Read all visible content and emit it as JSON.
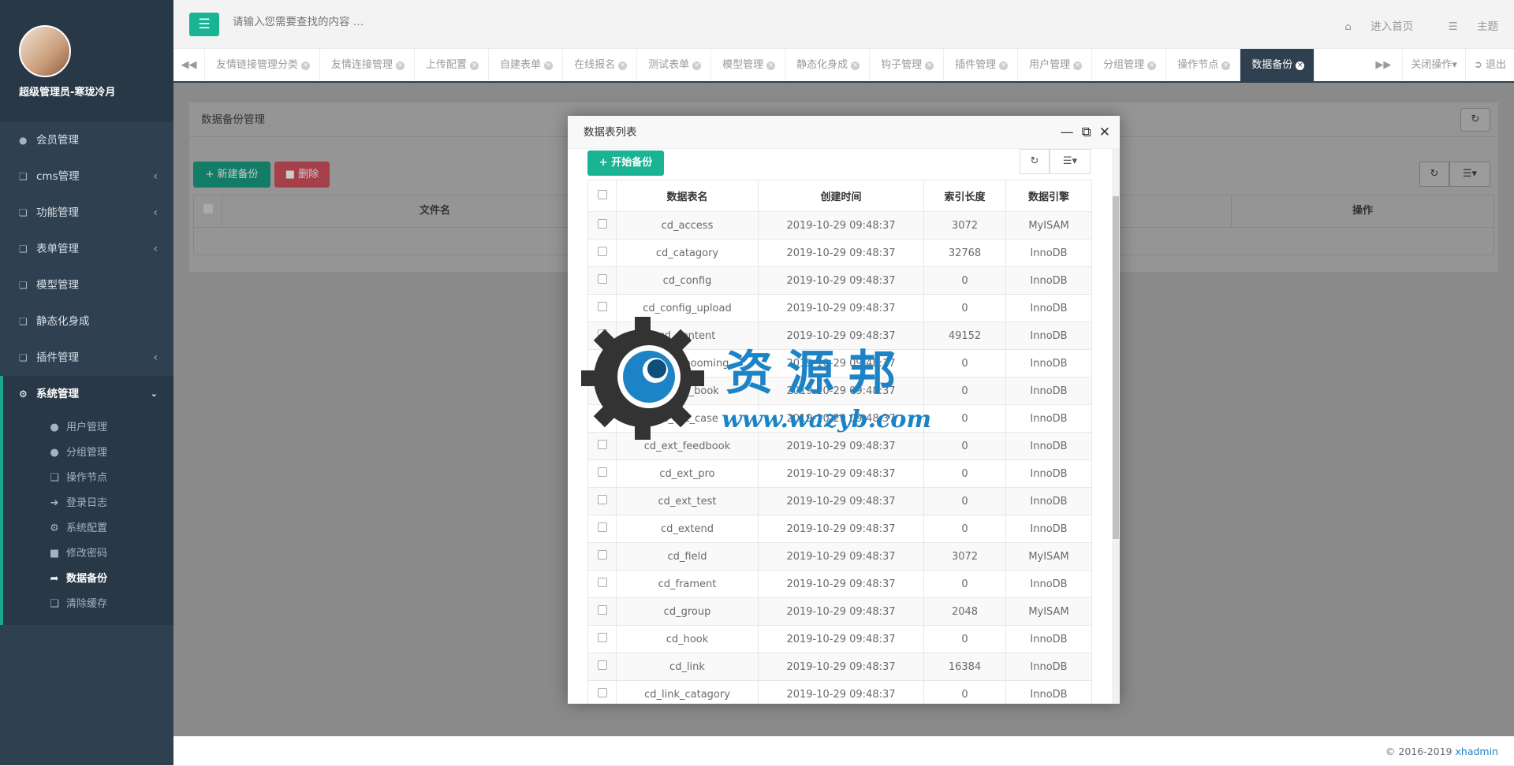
{
  "profile": {
    "name": "超级管理员-寒珑冷月"
  },
  "sidebar": {
    "items": [
      {
        "label": "会员管理",
        "icon": "user-icon",
        "arrow": false
      },
      {
        "label": "cms管理",
        "icon": "copy-icon",
        "arrow": true
      },
      {
        "label": "功能管理",
        "icon": "copy-icon",
        "arrow": true
      },
      {
        "label": "表单管理",
        "icon": "copy-icon",
        "arrow": true
      },
      {
        "label": "模型管理",
        "icon": "copy-icon",
        "arrow": false
      },
      {
        "label": "静态化身成",
        "icon": "copy-icon",
        "arrow": false
      },
      {
        "label": "插件管理",
        "icon": "copy-icon",
        "arrow": true
      }
    ],
    "open_item": {
      "label": "系统管理",
      "icon": "cogs-icon"
    },
    "sub_items": [
      {
        "label": "用户管理",
        "icon": "user-secret-icon"
      },
      {
        "label": "分组管理",
        "icon": "user-icon"
      },
      {
        "label": "操作节点",
        "icon": "copy-icon"
      },
      {
        "label": "登录日志",
        "icon": "sign-in-icon"
      },
      {
        "label": "系统配置",
        "icon": "gear-icon"
      },
      {
        "label": "修改密码",
        "icon": "lock-icon"
      },
      {
        "label": "数据备份",
        "icon": "share-icon"
      },
      {
        "label": "清除缓存",
        "icon": "copy-icon"
      }
    ],
    "active_sub": "数据备份"
  },
  "topbar": {
    "search_placeholder": "请输入您需要查找的内容 …",
    "home_label": "进入首页",
    "theme_label": "主题"
  },
  "tabs": {
    "items": [
      "友情链接管理分类",
      "友情连接管理",
      "上传配置",
      "自建表单",
      "在线报名",
      "测试表单",
      "模型管理",
      "静态化身成",
      "钩子管理",
      "插件管理",
      "用户管理",
      "分组管理",
      "操作节点",
      "数据备份"
    ],
    "active": "数据备份",
    "close_ops_label": "关闭操作",
    "logout_label": "退出"
  },
  "page": {
    "panel_title": "数据备份管理",
    "new_backup_label": "新建备份",
    "delete_label": "删除",
    "col_filename": "文件名",
    "col_actions": "操作"
  },
  "modal": {
    "title": "数据表列表",
    "start_label": "开始备份",
    "columns": [
      "数据表名",
      "创建时间",
      "索引长度",
      "数据引擎"
    ],
    "rows": [
      [
        "cd_access",
        "2019-10-29 09:48:37",
        "3072",
        "MyISAM"
      ],
      [
        "cd_catagory",
        "2019-10-29 09:48:37",
        "32768",
        "InnoDB"
      ],
      [
        "cd_config",
        "2019-10-29 09:48:37",
        "0",
        "InnoDB"
      ],
      [
        "cd_config_upload",
        "2019-10-29 09:48:37",
        "0",
        "InnoDB"
      ],
      [
        "cd_content",
        "2019-10-29 09:48:37",
        "49152",
        "InnoDB"
      ],
      [
        "cd_ext_booming",
        "2019-10-29 09:48:37",
        "0",
        "InnoDB"
      ],
      [
        "cd_ext_book",
        "2019-10-29 09:48:37",
        "0",
        "InnoDB"
      ],
      [
        "cd_ext_case",
        "2019-10-29 09:48:37",
        "0",
        "InnoDB"
      ],
      [
        "cd_ext_feedbook",
        "2019-10-29 09:48:37",
        "0",
        "InnoDB"
      ],
      [
        "cd_ext_pro",
        "2019-10-29 09:48:37",
        "0",
        "InnoDB"
      ],
      [
        "cd_ext_test",
        "2019-10-29 09:48:37",
        "0",
        "InnoDB"
      ],
      [
        "cd_extend",
        "2019-10-29 09:48:37",
        "0",
        "InnoDB"
      ],
      [
        "cd_field",
        "2019-10-29 09:48:37",
        "3072",
        "MyISAM"
      ],
      [
        "cd_frament",
        "2019-10-29 09:48:37",
        "0",
        "InnoDB"
      ],
      [
        "cd_group",
        "2019-10-29 09:48:37",
        "2048",
        "MyISAM"
      ],
      [
        "cd_hook",
        "2019-10-29 09:48:37",
        "0",
        "InnoDB"
      ],
      [
        "cd_link",
        "2019-10-29 09:48:37",
        "16384",
        "InnoDB"
      ],
      [
        "cd_link_catagory",
        "2019-10-29 09:48:37",
        "0",
        "InnoDB"
      ]
    ]
  },
  "footer": {
    "copyright": "© 2016-2019 ",
    "brand": "xhadmin"
  },
  "watermark": {
    "text": "资源邦",
    "url": "www.wazyb.com"
  },
  "colors": {
    "accent": "#1ab394",
    "sidebar": "#2f4050",
    "danger": "#ed5565",
    "link": "#1c84c6"
  }
}
